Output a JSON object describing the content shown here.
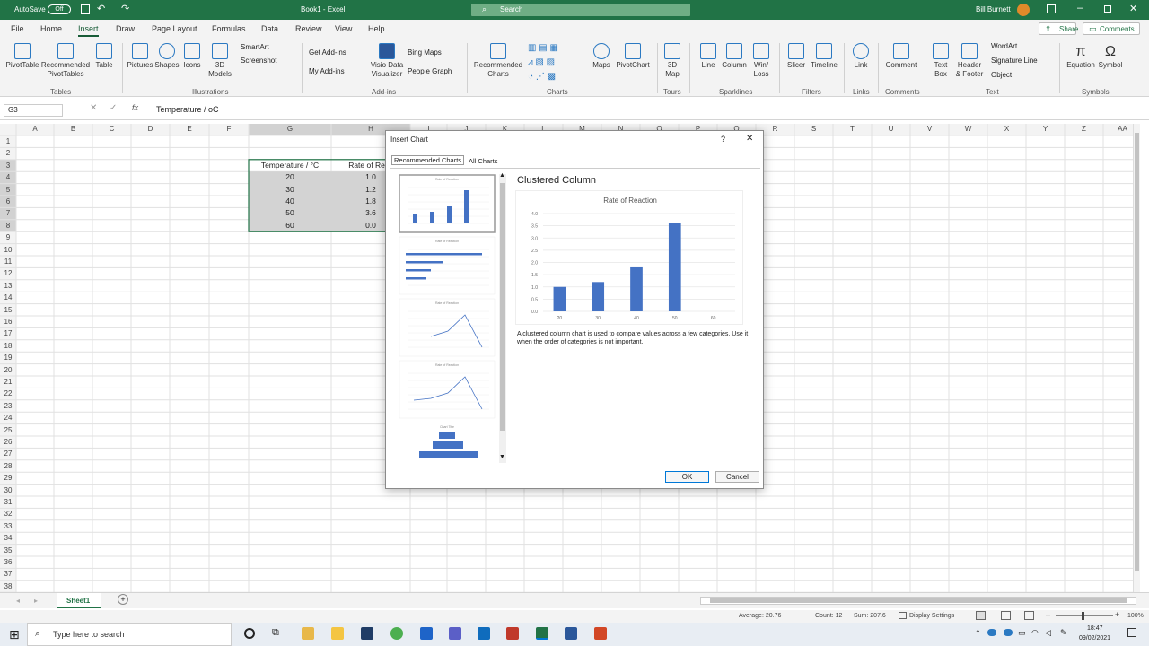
{
  "titlebar": {
    "autosave_label": "AutoSave",
    "autosave_state": "Off",
    "title": "Book1 - Excel",
    "search_placeholder": "Search",
    "user": "Bill Burnett"
  },
  "tabs": [
    "File",
    "Home",
    "Insert",
    "Draw",
    "Page Layout",
    "Formulas",
    "Data",
    "Review",
    "View",
    "Help"
  ],
  "share_label": "Share",
  "comments_label": "Comments",
  "ribbon": {
    "buttons": [
      {
        "l1": "PivotTable",
        "l2": ""
      },
      {
        "l1": "Recommended",
        "l2": "PivotTables"
      },
      {
        "l1": "Table",
        "l2": ""
      },
      {
        "l1": "Pictures",
        "l2": ""
      },
      {
        "l1": "Shapes",
        "l2": ""
      },
      {
        "l1": "Icons",
        "l2": ""
      },
      {
        "l1": "3D",
        "l2": "Models"
      },
      {
        "l1": "Visio Data",
        "l2": "Visualizer"
      },
      {
        "l1": "Recommended",
        "l2": "Charts"
      },
      {
        "l1": "Maps",
        "l2": ""
      },
      {
        "l1": "PivotChart",
        "l2": ""
      },
      {
        "l1": "3D",
        "l2": "Map"
      },
      {
        "l1": "Line",
        "l2": ""
      },
      {
        "l1": "Column",
        "l2": ""
      },
      {
        "l1": "Win/",
        "l2": "Loss"
      },
      {
        "l1": "Slicer",
        "l2": ""
      },
      {
        "l1": "Timeline",
        "l2": ""
      },
      {
        "l1": "Link",
        "l2": ""
      },
      {
        "l1": "Comment",
        "l2": ""
      },
      {
        "l1": "Text",
        "l2": "Box"
      },
      {
        "l1": "Header",
        "l2": "& Footer"
      },
      {
        "l1": "Equation",
        "l2": ""
      },
      {
        "l1": "Symbol",
        "l2": ""
      }
    ],
    "small": [
      "SmartArt",
      "Screenshot",
      "Get Add-ins",
      "My Add-ins",
      "Bing Maps",
      "People Graph",
      "WordArt",
      "Signature Line",
      "Object"
    ],
    "groups": [
      "Tables",
      "Illustrations",
      "Add-ins",
      "Charts",
      "Tours",
      "Sparklines",
      "Filters",
      "Links",
      "Comments",
      "Text",
      "Symbols"
    ]
  },
  "formula": {
    "namebox": "G3",
    "content": "Temperature / oC"
  },
  "sheet": {
    "columns": [
      "A",
      "B",
      "C",
      "D",
      "E",
      "F",
      "G",
      "H",
      "I",
      "J",
      "K",
      "L",
      "M",
      "N",
      "O",
      "P",
      "Q",
      "R",
      "S",
      "T",
      "U",
      "V",
      "W",
      "X",
      "Y",
      "Z",
      "AA"
    ],
    "rows": [
      "1",
      "2",
      "3",
      "4",
      "5",
      "6",
      "7",
      "8",
      "9",
      "10",
      "11",
      "12",
      "13",
      "14",
      "15",
      "16",
      "17",
      "18",
      "19",
      "20",
      "21",
      "22",
      "23",
      "24",
      "25",
      "26",
      "27",
      "28",
      "29",
      "30",
      "31",
      "32",
      "33",
      "34",
      "35",
      "36",
      "37",
      "38"
    ],
    "header_g": "Temperature / °C",
    "header_h": "Rate of Reac",
    "data": [
      [
        "20",
        "1.0"
      ],
      [
        "30",
        "1.2"
      ],
      [
        "40",
        "1.8"
      ],
      [
        "50",
        "3.6"
      ],
      [
        "60",
        "0.0"
      ]
    ]
  },
  "dialog": {
    "title": "Insert Chart",
    "help": "?",
    "close": "✕",
    "tab_recommended": "Recommended Charts",
    "tab_all": "All Charts",
    "thumb_title": "Rate of Reaction",
    "thumb_funnel_title": "Chart Title",
    "chart_type_name": "Clustered Column",
    "description": "A clustered column chart is used to compare values across a few categories. Use it when the order of categories is not important.",
    "ok": "OK",
    "cancel": "Cancel"
  },
  "chart_data": {
    "type": "bar",
    "title": "Rate of Reaction",
    "categories": [
      "20",
      "30",
      "40",
      "50",
      "60"
    ],
    "values": [
      1.0,
      1.2,
      1.8,
      3.6,
      0.0
    ],
    "yticks": [
      "0.0",
      "0.5",
      "1.0",
      "1.5",
      "2.0",
      "2.5",
      "3.0",
      "3.5",
      "4.0"
    ],
    "ylim": [
      0,
      4.0
    ],
    "xlabel": "",
    "ylabel": "",
    "color": "#4472c4"
  },
  "sheet_tab": "Sheet1",
  "statusbar": {
    "average": "Average: 20.76",
    "count": "Count: 12",
    "sum": "Sum: 207.6",
    "display": "Display Settings",
    "zoom": "100%"
  },
  "taskbar": {
    "search": "Type here to search",
    "time": "18:47",
    "date": "09/02/2021"
  },
  "colors": {
    "excel_green": "#217346",
    "accent_blue": "#4472c4",
    "selection": "#d3d3d3"
  }
}
